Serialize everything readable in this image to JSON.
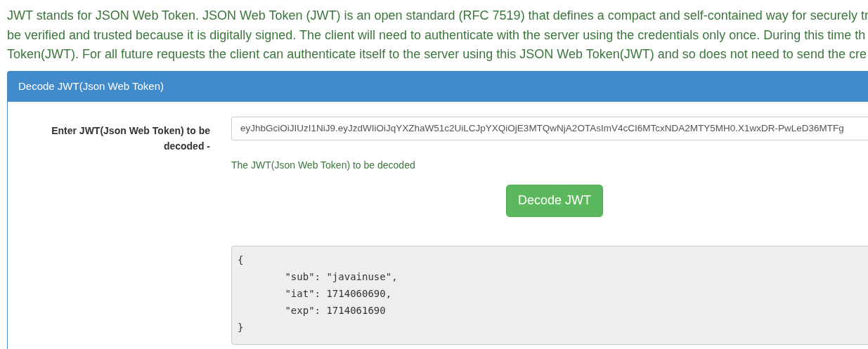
{
  "intro_lines": [
    "JWT stands for JSON Web Token. JSON Web Token (JWT) is an open standard (RFC 7519) that defines a compact and self-contained way for securely tr",
    "be verified and trusted because it is digitally signed. The client will need to authenticate with the server using the credentials only once. During this time th",
    "Token(JWT). For all future requests the client can authenticate itself to the server using this JSON Web Token(JWT) and so does not need to send the cre"
  ],
  "panel": {
    "title": "Decode JWT(Json Web Token)",
    "field_label": "Enter JWT(Json Web Token) to be decoded -",
    "token_value": "eyJhbGciOiJIUzI1NiJ9.eyJzdWIiOiJqYXZhaW51c2UiLCJpYXQiOjE3MTQwNjA2OTAsImV4cCI6MTcxNDA2MTY5MH0.X1wxDR-PwLeD36MTFg",
    "help_text": "The JWT(Json Web Token) to be decoded",
    "button": "Decode JWT",
    "output_lines": [
      "{",
      "        \"sub\": \"javainuse\",",
      "        \"iat\": 1714060690,",
      "        \"exp\": 1714061690",
      "}"
    ]
  }
}
